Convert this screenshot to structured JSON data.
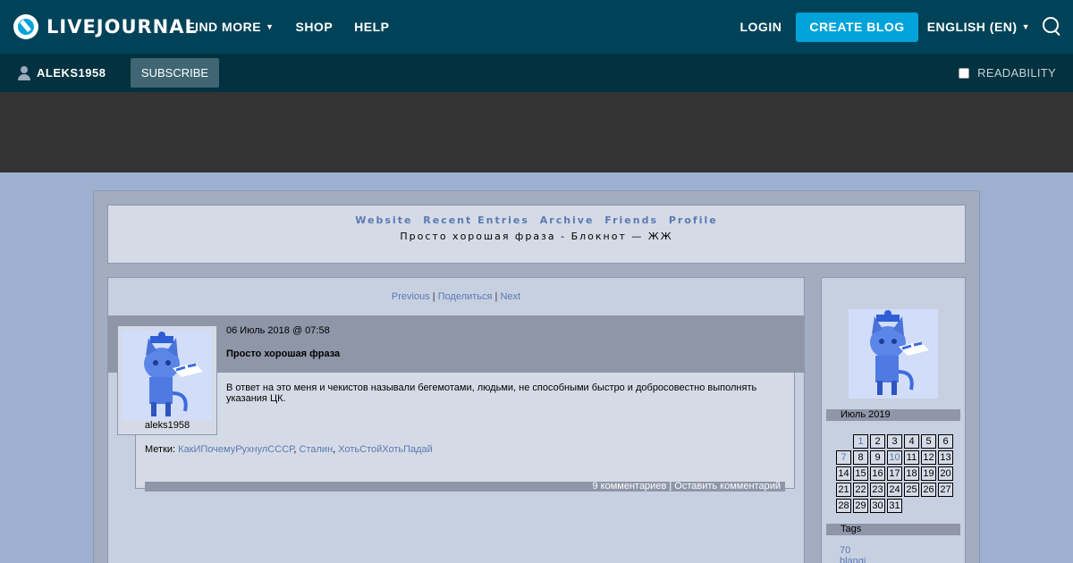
{
  "topbar": {
    "logo_text": "LIVEJOURNAL",
    "nav": [
      "FIND MORE",
      "SHOP",
      "HELP"
    ],
    "login": "LOGIN",
    "create_blog": "CREATE BLOG",
    "language": "ENGLISH (EN)"
  },
  "subbar": {
    "username": "ALEKS1958",
    "subscribe": "SUBSCRIBE",
    "readability": "READABILITY"
  },
  "journal": {
    "links": [
      "Website",
      "Recent Entries",
      "Archive",
      "Friends",
      "Profile"
    ],
    "title": "Просто хорошая фраза - Блокнот — ЖЖ"
  },
  "pager": {
    "previous": "Previous",
    "share": "Поделиться",
    "next": "Next",
    "separator": "|"
  },
  "entry": {
    "date": "06 Июль 2018 @ 07:58",
    "subject": "Просто хорошая фраза",
    "author": "aleks1958",
    "text": "В ответ на это меня и чекистов называли бегемотами, людьми, не способными быстро и добросовестно выполнять указания ЦК.",
    "tags_label": "Метки:",
    "tags": [
      "КакИПочемуРухнулСССР",
      "Сталин",
      "ХотьСтойХотьПадай"
    ],
    "comments": "9 комментариев",
    "leave_comment": "Оставить комментарий"
  },
  "sidebar": {
    "calendar_title": "Июль 2019",
    "calendar_rows": [
      [
        "",
        "1",
        "2",
        "3",
        "4",
        "5",
        "6"
      ],
      [
        "7",
        "8",
        "9",
        "10",
        "11",
        "12",
        "13"
      ],
      [
        "14",
        "15",
        "16",
        "17",
        "18",
        "19",
        "20"
      ],
      [
        "21",
        "22",
        "23",
        "24",
        "25",
        "26",
        "27"
      ],
      [
        "28",
        "29",
        "30",
        "31",
        "",
        "",
        ""
      ]
    ],
    "calendar_linked_days": [
      "1",
      "7",
      "10"
    ],
    "tags_title": "Tags",
    "tags": [
      "70",
      "blangi"
    ]
  },
  "colors": {
    "topbar": "#004359",
    "accent": "#00a3d9",
    "link": "#5b79b3",
    "page_bg": "#9eb0cf"
  },
  "icons": [
    "livejournal-logo-icon",
    "chevron-down-icon",
    "search-icon",
    "user-icon",
    "checkbox-icon"
  ]
}
